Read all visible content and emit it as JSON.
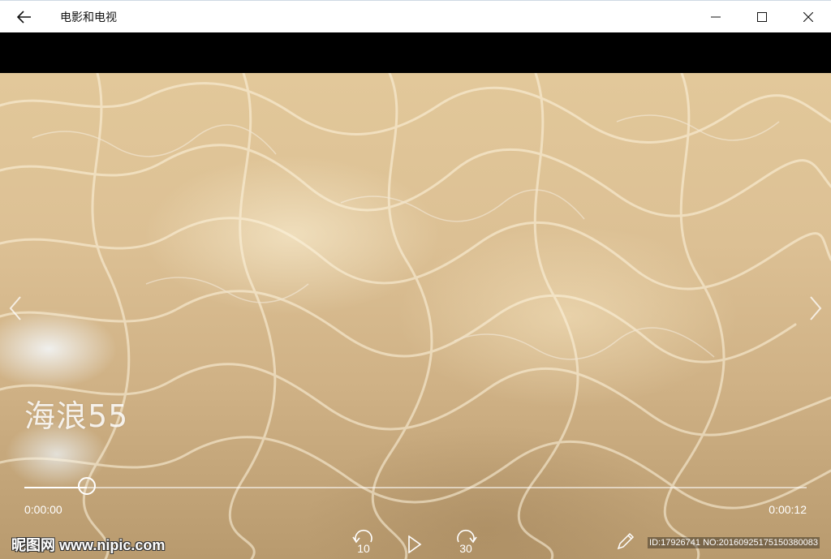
{
  "window": {
    "title": "电影和电视"
  },
  "video": {
    "title": "海浪55",
    "progress_fraction": 0.08,
    "time_current": "0:00:00",
    "time_total": "0:00:12"
  },
  "controls": {
    "skip_back_seconds": "10",
    "skip_forward_seconds": "30"
  },
  "watermark": {
    "site_text": "昵图网 www.nipic.com",
    "id_text": "ID:17926741 NO:20160925175150380083"
  },
  "icons": {
    "back": "back-arrow-icon",
    "minimize": "minimize-icon",
    "maximize": "maximize-icon",
    "close": "close-icon",
    "prev": "chevron-left-icon",
    "next": "chevron-right-icon",
    "skip_back": "skip-back-icon",
    "play": "play-icon",
    "skip_forward": "skip-forward-icon",
    "pen": "pen-icon"
  },
  "colors": {
    "titlebar_bg": "#ffffff",
    "video_tone": "#dcc094"
  }
}
